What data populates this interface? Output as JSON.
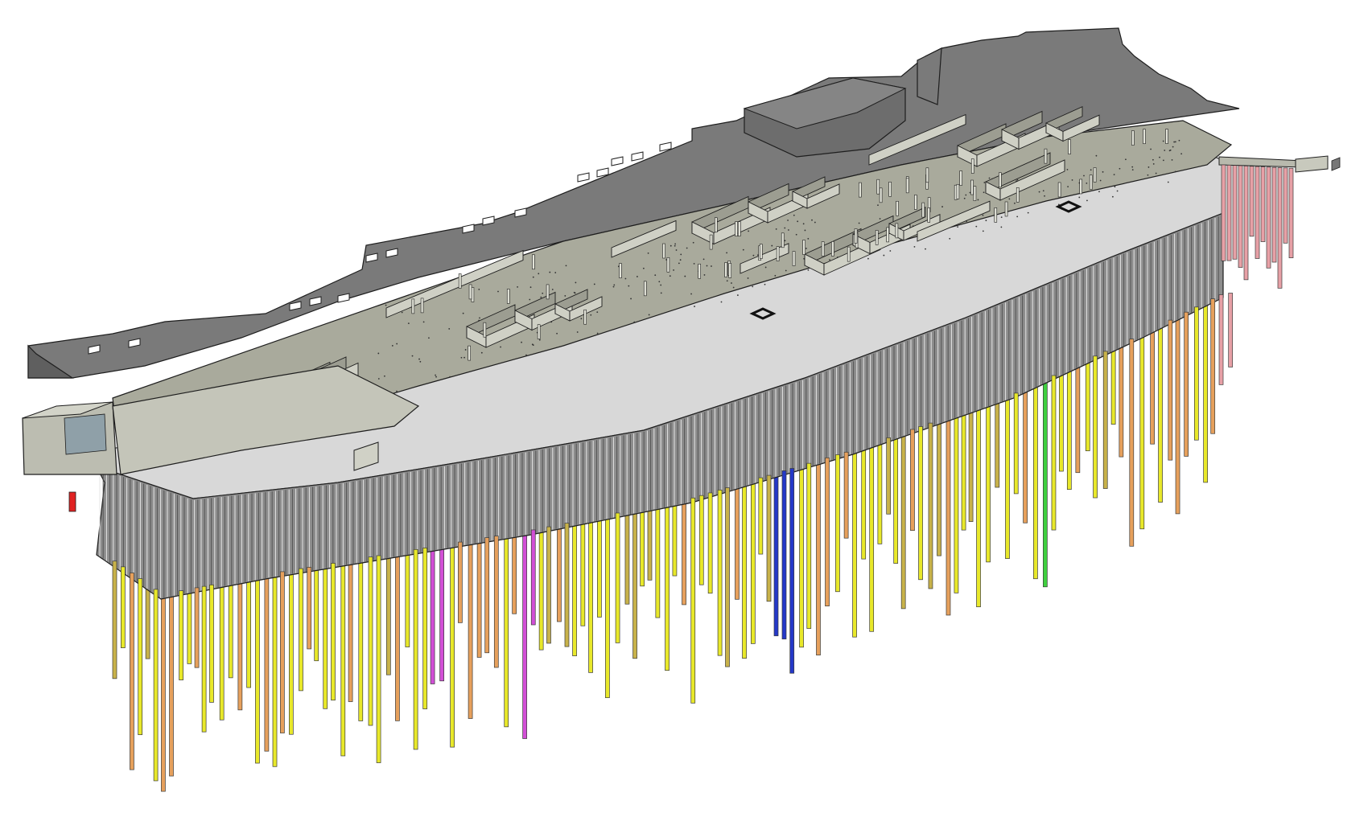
{
  "colors": {
    "background": "#ffffff",
    "roof_slab": "#7a7a7a",
    "roof_slab_edge": "#4a4a4a",
    "floor_slab": "#a9aa9c",
    "floor_slab_light": "#bfc0b3",
    "wall_top": "#cfd0c5",
    "wall_side": "#9c9d91",
    "outline": "#1e1e1e",
    "diaphragm_wall_light": "#d8d8d8",
    "diaphragm_wall_dark": "#8d8d8d",
    "pile_yellow": "#e8e82a",
    "pile_orange": "#e6a05c",
    "pile_khaki": "#c8b24a",
    "pile_magenta": "#d24fd6",
    "pile_blue": "#2438c8",
    "pile_green": "#3fcf3f",
    "pile_red": "#e02222",
    "pile_pink": "#e7a0a6"
  },
  "model": {
    "kind": "isometric-structural-bim-model",
    "elements": [
      "roof-slab",
      "floor-slab",
      "interior-walls",
      "columns",
      "diaphragm-wall",
      "bored-piles",
      "access-bridge"
    ]
  }
}
